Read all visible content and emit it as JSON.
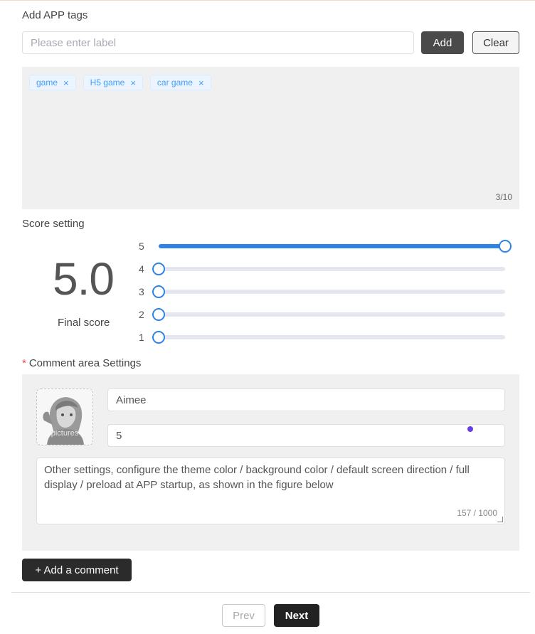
{
  "tags_section": {
    "title": "Add APP tags",
    "input_placeholder": "Please enter label",
    "add_label": "Add",
    "clear_label": "Clear",
    "tags": [
      "game",
      "H5 game",
      "car game"
    ],
    "close_glyph": "×",
    "count_text": "3/10"
  },
  "score_section": {
    "title": "Score setting",
    "final_score": "5.0",
    "final_caption": "Final score",
    "accent_color": "#2e83e6",
    "sliders": [
      {
        "label": "5",
        "value_percent": 100
      },
      {
        "label": "4",
        "value_percent": 0
      },
      {
        "label": "3",
        "value_percent": 0
      },
      {
        "label": "2",
        "value_percent": 0
      },
      {
        "label": "1",
        "value_percent": 0
      }
    ]
  },
  "comment_section": {
    "required_mark": "*",
    "title": "Comment area Settings",
    "avatar_label": "pictures",
    "name_value": "Aimee",
    "score_value": "5",
    "comment_text": "Other settings, configure the theme color / background color / default screen direction / full display / preload at APP startup, as shown in the figure below",
    "char_count": "157 / 1000",
    "add_comment_label": "+ Add a comment"
  },
  "footer": {
    "prev_label": "Prev",
    "next_label": "Next"
  }
}
